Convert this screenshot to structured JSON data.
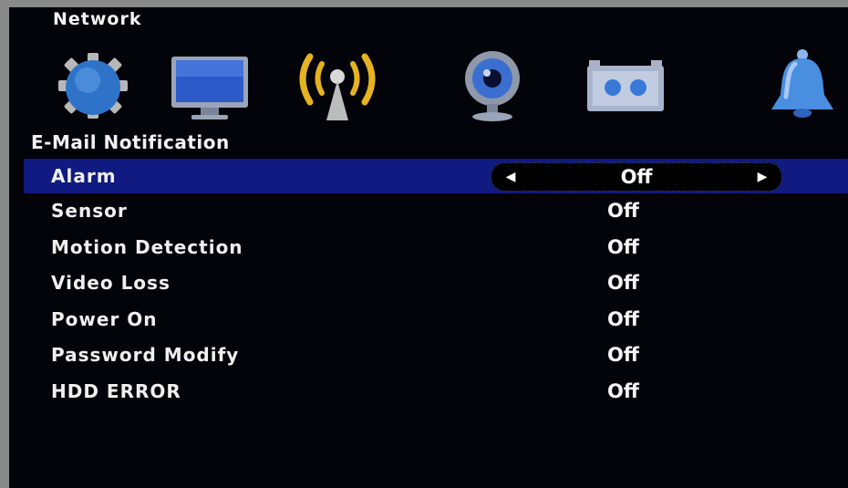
{
  "header": {
    "title": "Network"
  },
  "icon_bar": {
    "items": [
      {
        "icon": "gear-icon",
        "color": "#2f73c9"
      },
      {
        "icon": "monitor-icon",
        "color": "#2c5ac8"
      },
      {
        "icon": "network-broadcast-icon",
        "color": "#e6b320"
      },
      {
        "icon": "webcam-icon",
        "color": "#3a6fcf"
      },
      {
        "icon": "recorder-icon",
        "color": "#6a9fe8"
      },
      {
        "icon": "bell-icon",
        "color": "#4a8ee0"
      }
    ],
    "active_index": 2
  },
  "section": {
    "title": "E-Mail Notification"
  },
  "rows": [
    {
      "label": "Alarm",
      "value": "Off",
      "selected": true
    },
    {
      "label": "Sensor",
      "value": "Off"
    },
    {
      "label": "Motion Detection",
      "value": "Off"
    },
    {
      "label": "Video Loss",
      "value": "Off"
    },
    {
      "label": "Power On",
      "value": "Off"
    },
    {
      "label": "Password Modify",
      "value": "Off"
    },
    {
      "label": "HDD ERROR",
      "value": "Off"
    }
  ],
  "colors": {
    "background": "#03030a",
    "selection": "#101a80",
    "text": "#ffffff"
  }
}
